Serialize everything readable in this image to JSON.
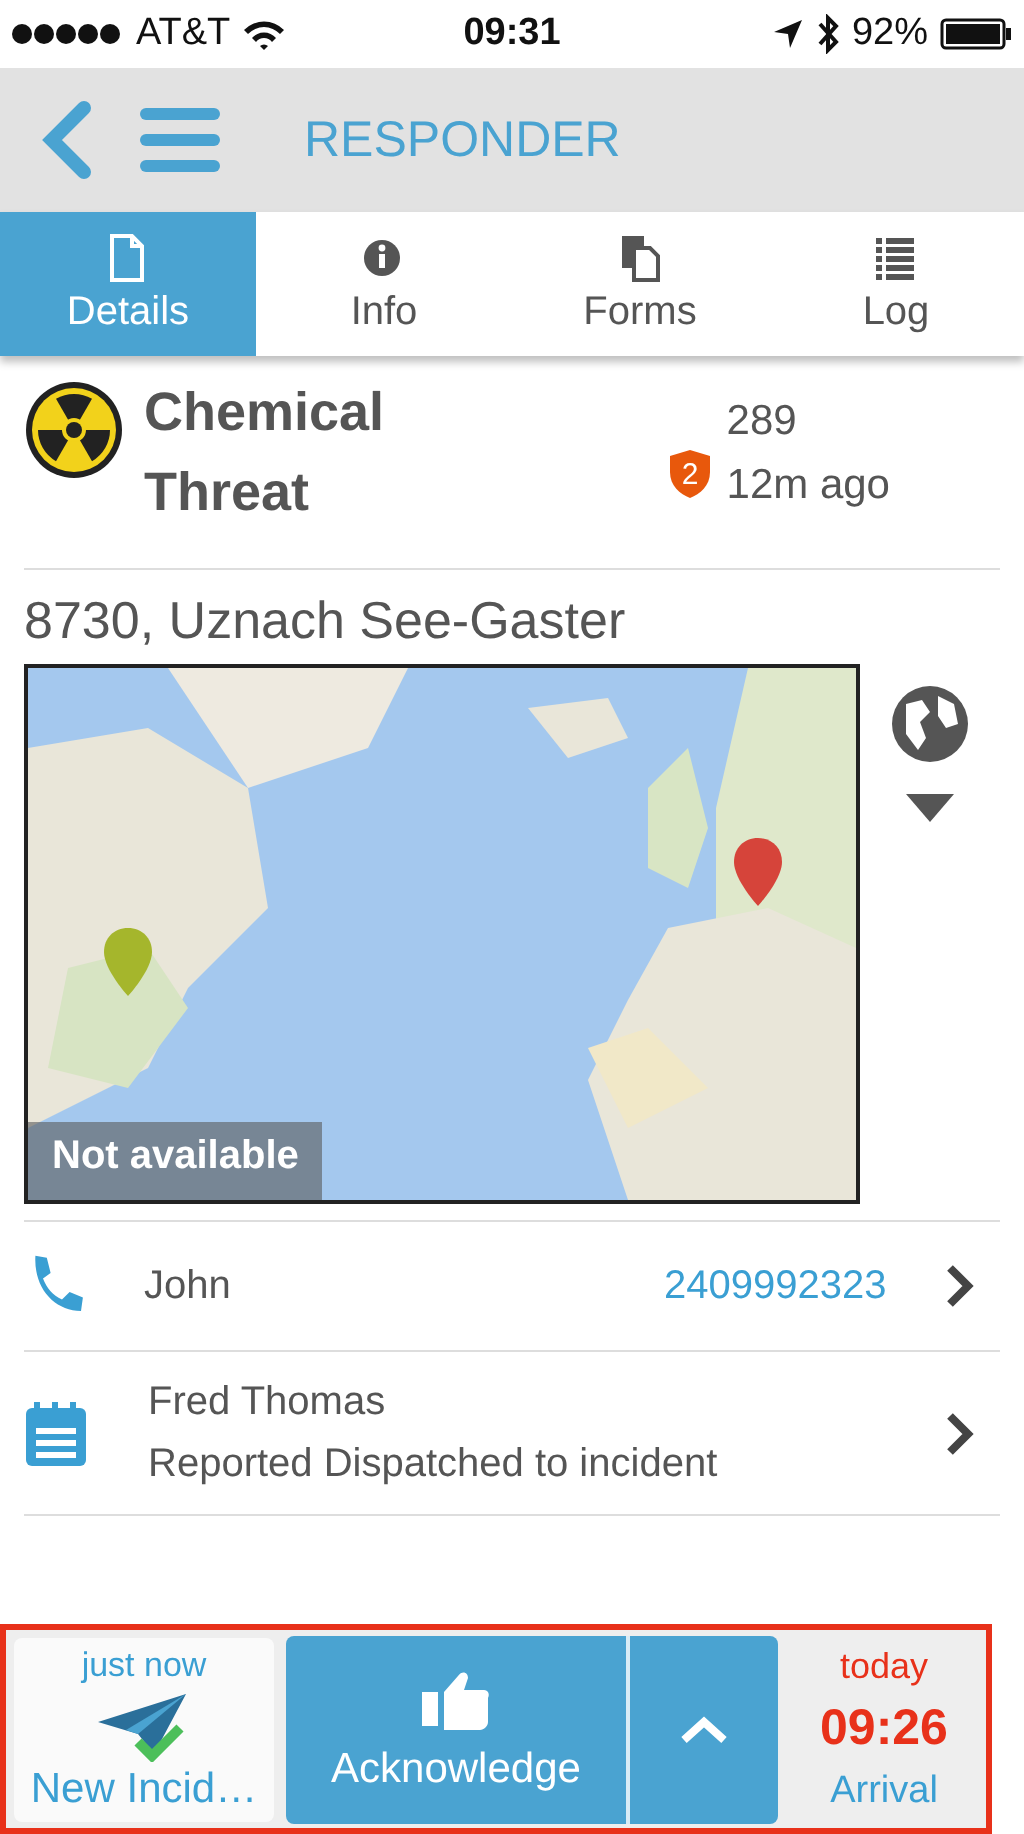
{
  "status_bar": {
    "carrier": "AT&T",
    "time": "09:31",
    "battery": "92%"
  },
  "header": {
    "title": "RESPONDER"
  },
  "tabs": [
    {
      "label": "Details",
      "kind": "document",
      "selected": true
    },
    {
      "label": "Info",
      "kind": "info",
      "selected": false
    },
    {
      "label": "Forms",
      "kind": "forms",
      "selected": false
    },
    {
      "label": "Log",
      "kind": "list",
      "selected": false
    }
  ],
  "incident": {
    "title": "Chemical Threat",
    "badge": "2",
    "number": "289",
    "age": "12m ago"
  },
  "address": "8730, Uznach See-Gaster",
  "map": {
    "overlay": "Not available"
  },
  "contacts": [
    {
      "kind": "phone",
      "name": "John",
      "phone": "2409992323"
    },
    {
      "kind": "report",
      "name": "Fred Thomas",
      "detail": "Reported Dispatched to incident"
    }
  ],
  "action_bar": {
    "status": {
      "time": "just now",
      "label": "New Incid…"
    },
    "button": "Acknowledge",
    "arrival": {
      "day": "today",
      "time": "09:26",
      "label": "Arrival"
    }
  }
}
